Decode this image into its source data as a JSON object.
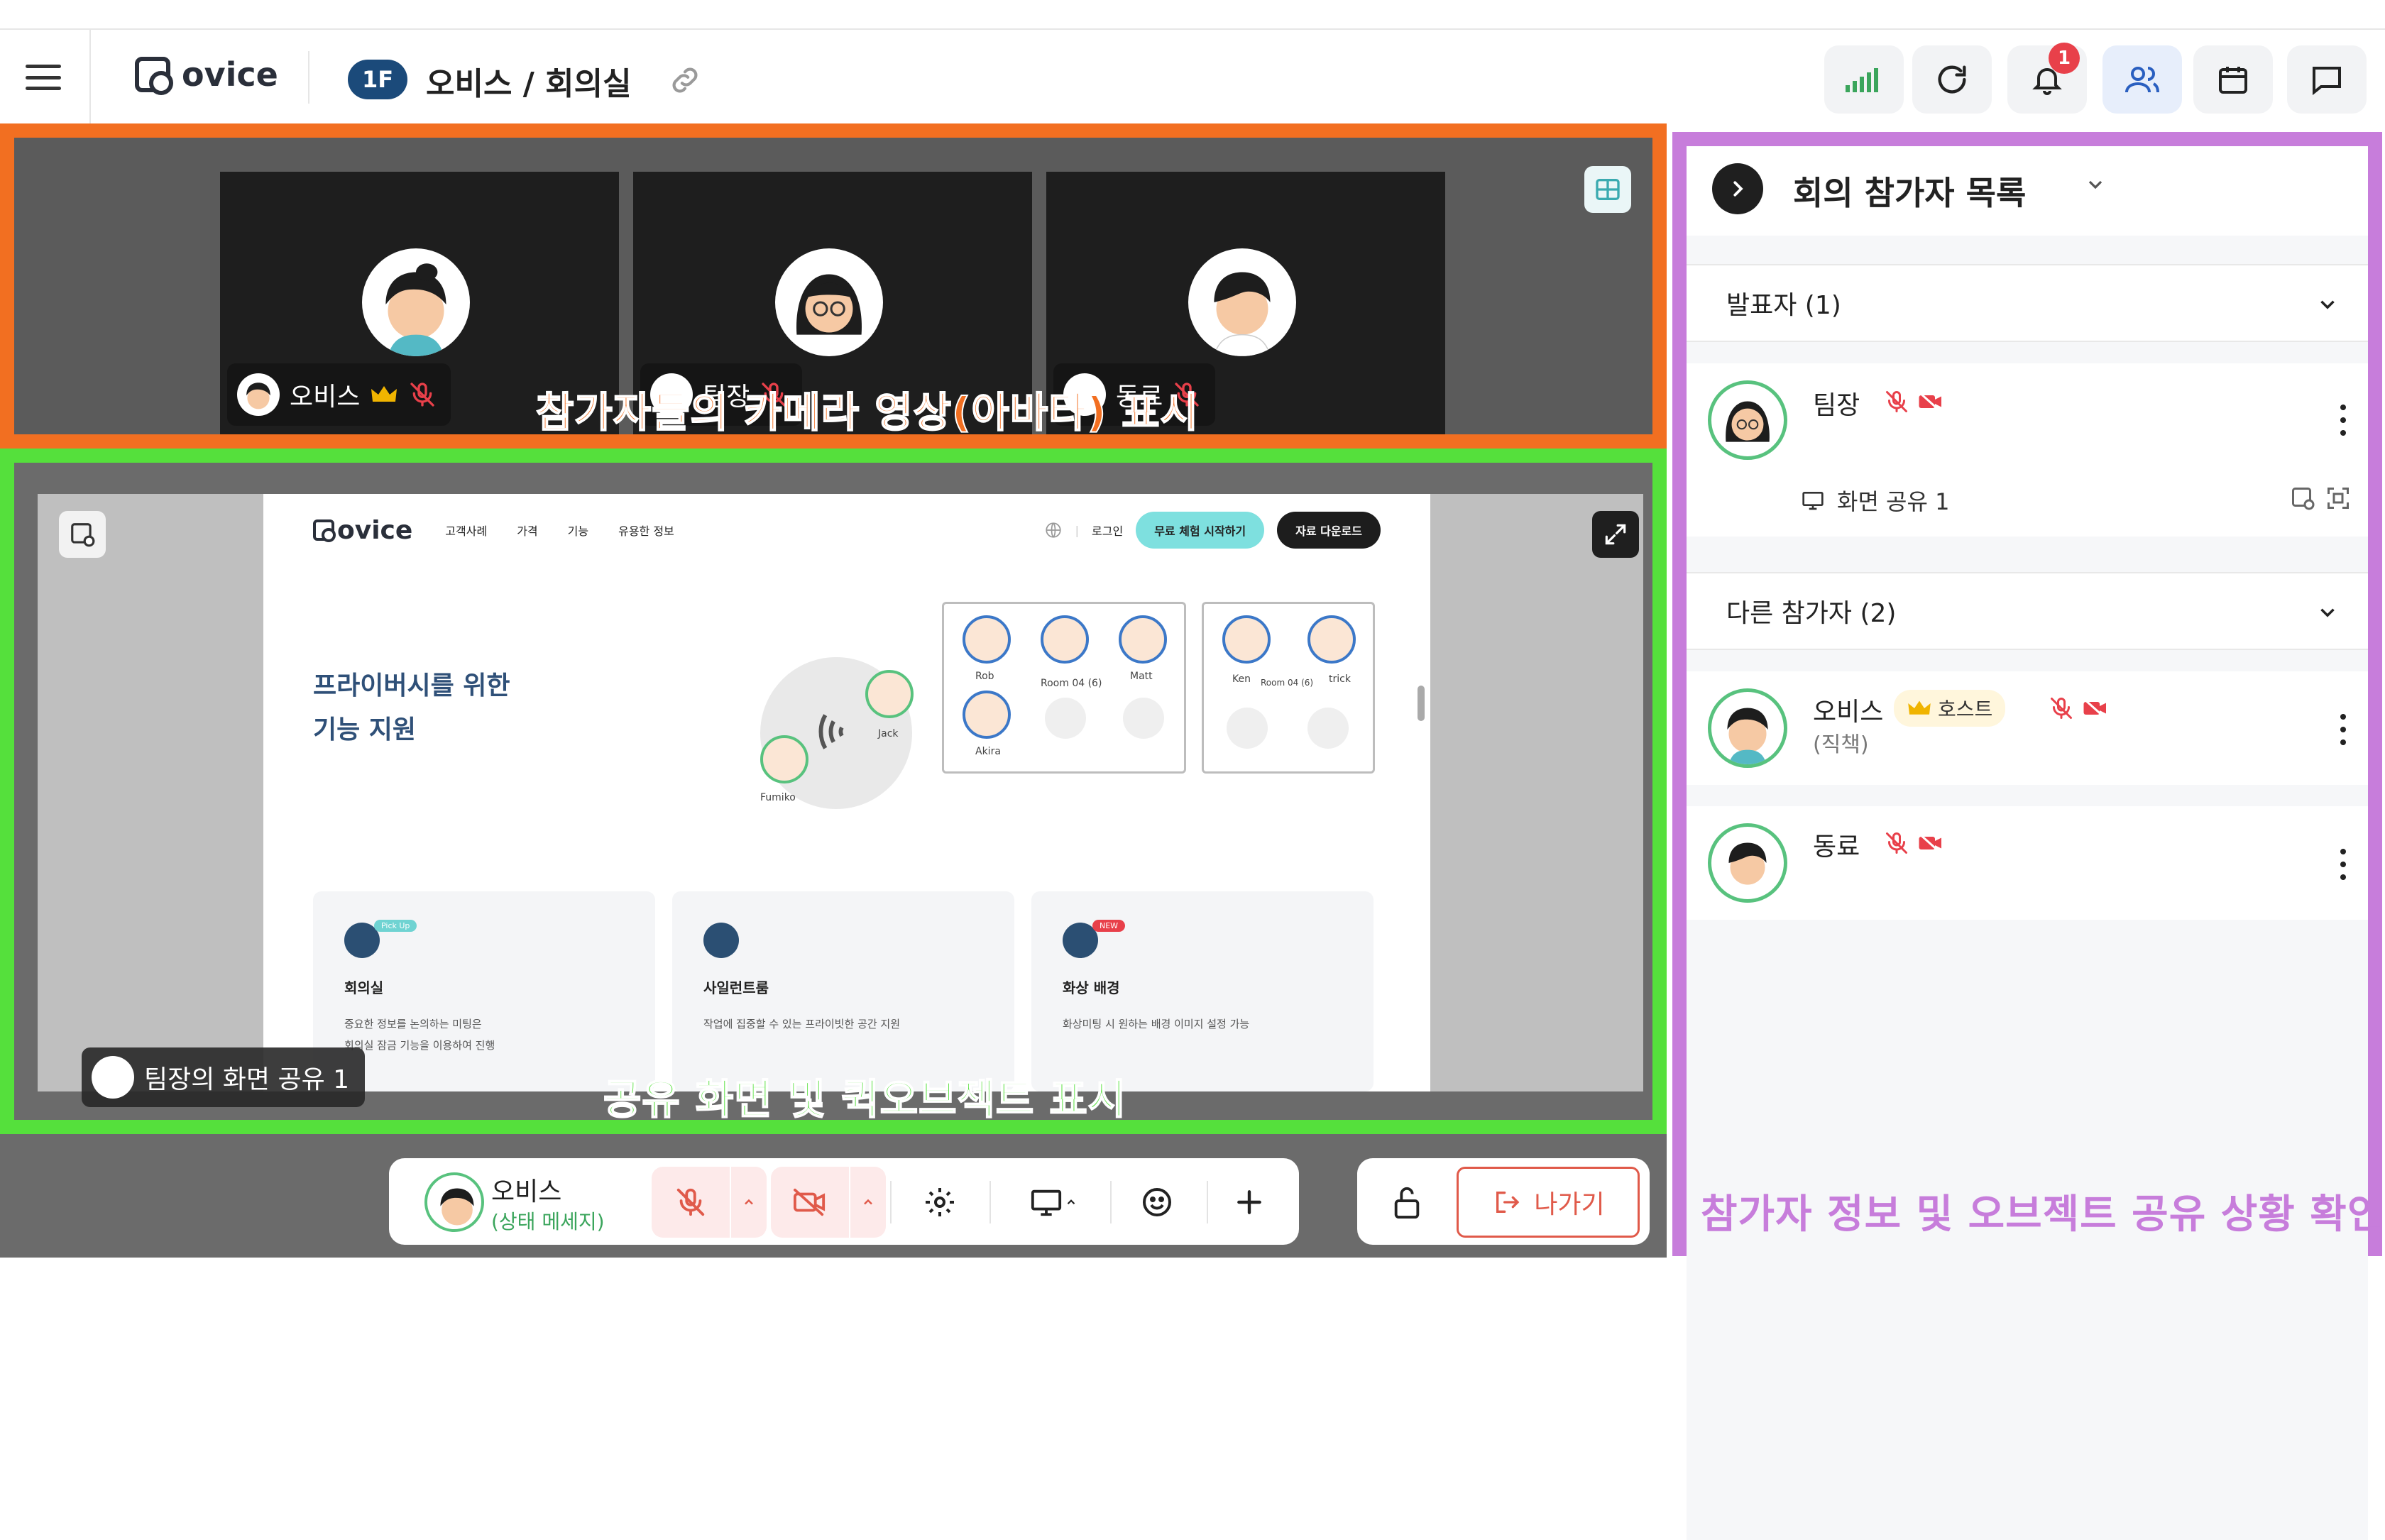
{
  "topbar": {
    "floor_badge": "1F",
    "room_title": "오비스 / 회의실",
    "notification_count": "1"
  },
  "video_strip": {
    "tiles": [
      {
        "name": "오비스",
        "host": true,
        "mic_muted": true
      },
      {
        "name": "팀장",
        "host": false,
        "mic_muted": true
      },
      {
        "name": "동료",
        "host": false,
        "mic_muted": true
      }
    ],
    "annotation": "참가자들의 카메라 영상(아바타) 표시",
    "annotation_color": "#f26f21"
  },
  "shared_screen": {
    "label": "팀장의 화면 공유 1",
    "annotation": "공유 화면 및 퀵오브젝트 표시",
    "annotation_color": "#55e03c",
    "website": {
      "logo": "ovice",
      "nav": [
        "고객사례",
        "가격",
        "기능",
        "유용한 정보"
      ],
      "login": "로그인",
      "cta_primary": "무료 체험 시작하기",
      "cta_secondary": "자료 다운로드",
      "headline_line1": "프라이버시를 위한",
      "headline_line2": "기능 지원",
      "people": {
        "jack": "Jack",
        "fumiko": "Fumiko",
        "rob": "Rob",
        "matt": "Matt",
        "akira": "Akira",
        "room_a": "Room 04 (6)",
        "ken": "Ken",
        "room_b": "Room 04 (6)",
        "patrick": "trick"
      },
      "cards": [
        {
          "tag": "Pick Up",
          "tag_color": "#6fd3d2",
          "title": "회의실",
          "text1": "중요한 정보를 논의하는 미팅은",
          "text2": "회의실 잠금 기능을 이용하여 진행"
        },
        {
          "tag": "",
          "tag_color": "",
          "title": "사일런트룸",
          "text1": "작업에 집중할 수 있는 프라이빗한 공간 지원",
          "text2": ""
        },
        {
          "tag": "NEW",
          "tag_color": "#e8404a",
          "title": "화상 배경",
          "text1": "화상미팅 시 원하는 배경 이미지 설정 가능",
          "text2": ""
        }
      ]
    }
  },
  "control_bar": {
    "user_name": "오비스",
    "status_message": "(상태 메세지)",
    "leave_label": "나가기"
  },
  "participants_panel": {
    "title": "회의 참가자 목록",
    "presenter_section": "발표자 (1)",
    "presenter": {
      "name": "팀장",
      "share_label": "화면 공유 1"
    },
    "others_section": "다른 참가자 (2)",
    "others": [
      {
        "name": "오비스",
        "badge": "호스트",
        "subtitle": "(직책)"
      },
      {
        "name": "동료",
        "badge": "",
        "subtitle": ""
      }
    ],
    "annotation": "참가자 정보 및 오브젝트 공유 상황 확인",
    "annotation_color": "#c77ddb"
  },
  "colors": {
    "accent_blue": "#1b4a7a",
    "mute_red": "#e05a4a",
    "avatar_ring": "#58c27e"
  }
}
